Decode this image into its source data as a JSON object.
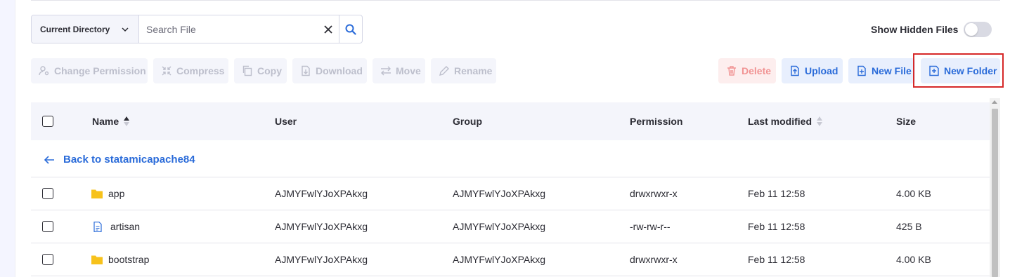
{
  "search": {
    "directory_label": "Current Directory",
    "placeholder": "Search File",
    "value": ""
  },
  "show_hidden": {
    "label": "Show Hidden Files",
    "enabled": false
  },
  "toolbar": {
    "change_permission": "Change Permission",
    "compress": "Compress",
    "copy": "Copy",
    "download": "Download",
    "move": "Move",
    "rename": "Rename",
    "delete": "Delete",
    "upload": "Upload",
    "new_file": "New File",
    "new_folder": "New Folder"
  },
  "table": {
    "columns": {
      "name": "Name",
      "user": "User",
      "group": "Group",
      "permission": "Permission",
      "last_modified": "Last modified",
      "size": "Size"
    },
    "back_link": "Back to statamicapache84",
    "rows": [
      {
        "type": "folder",
        "name": "app",
        "user": "AJMYFwlYJoXPAkxg",
        "group": "AJMYFwlYJoXPAkxg",
        "permission": "drwxrwxr-x",
        "modified": "Feb 11 12:58",
        "size": "4.00 KB"
      },
      {
        "type": "file",
        "name": "artisan",
        "user": "AJMYFwlYJoXPAkxg",
        "group": "AJMYFwlYJoXPAkxg",
        "permission": "-rw-rw-r--",
        "modified": "Feb 11 12:58",
        "size": "425 B"
      },
      {
        "type": "folder",
        "name": "bootstrap",
        "user": "AJMYFwlYJoXPAkxg",
        "group": "AJMYFwlYJoXPAkxg",
        "permission": "drwxrwxr-x",
        "modified": "Feb 11 12:58",
        "size": "4.00 KB"
      }
    ]
  },
  "colors": {
    "accent": "#2a6bd9",
    "folder": "#f7c21b",
    "danger": "#f19393",
    "highlight": "#d62828"
  }
}
